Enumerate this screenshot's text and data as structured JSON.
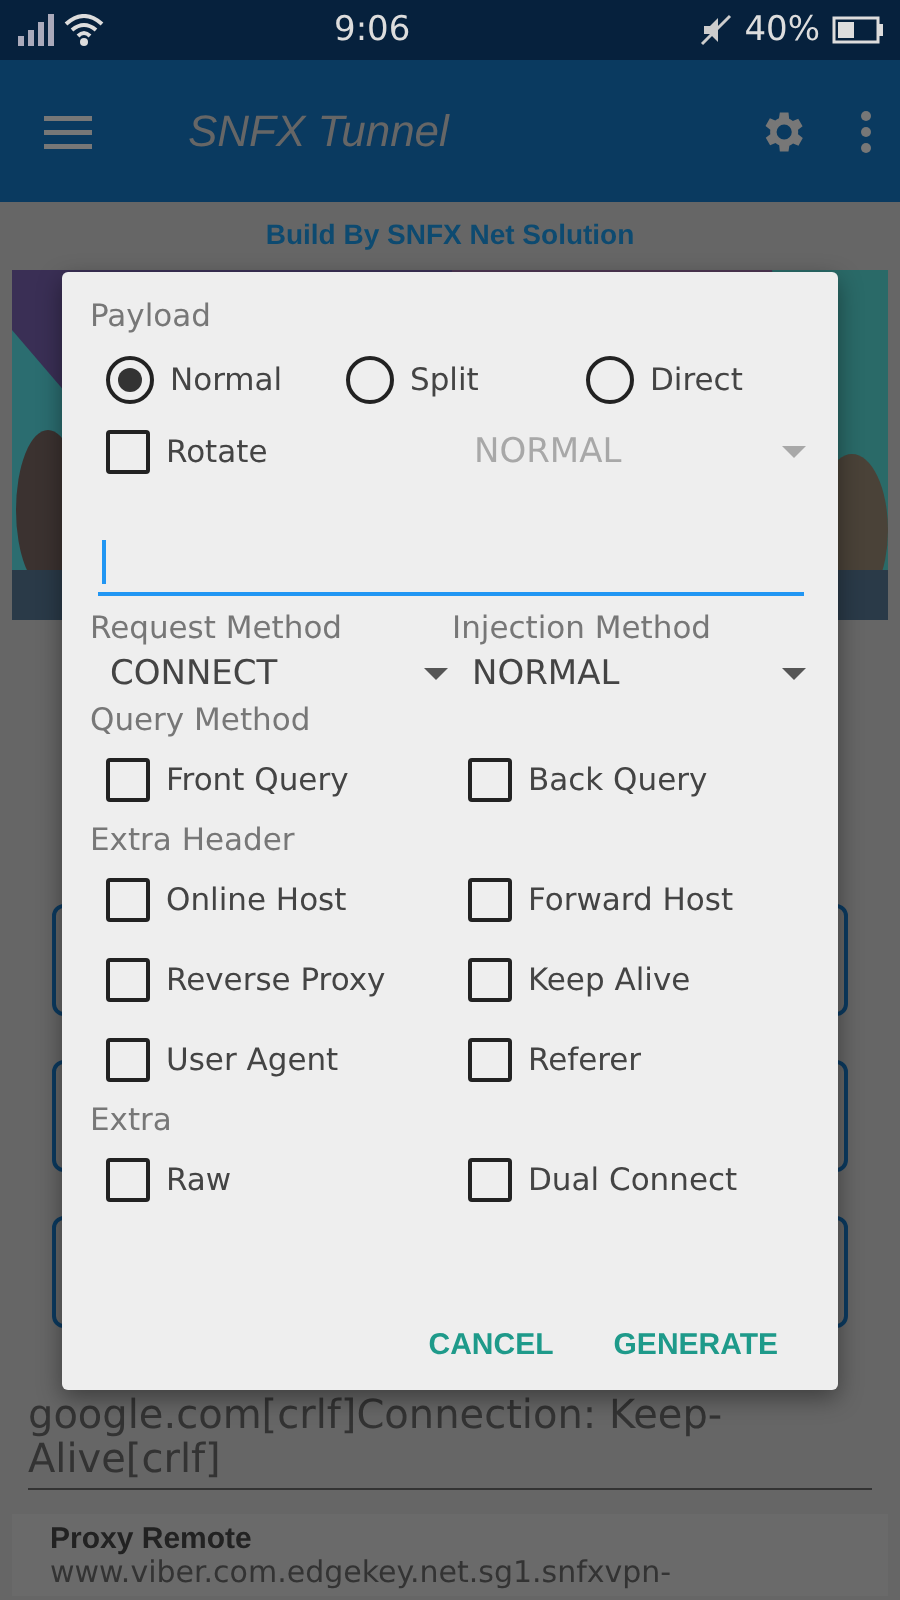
{
  "status_bar": {
    "time": "9:06",
    "battery": "40%"
  },
  "app_bar": {
    "title": "SNFX Tunnel"
  },
  "credit": "Build By SNFX Net Solution",
  "payload_field": {
    "lines": [
      "google.com[crlf]Connection: Keep-",
      "Alive[crlf]"
    ]
  },
  "proxy_card": {
    "label": "Proxy Remote",
    "value": "www.viber.com.edgekey.net.sg1.snfxvpn-"
  },
  "dialog": {
    "title": "Payload",
    "modes": [
      {
        "label": "Normal",
        "selected": true
      },
      {
        "label": "Split",
        "selected": false
      },
      {
        "label": "Direct",
        "selected": false
      }
    ],
    "rotate": {
      "label": "Rotate",
      "checked": false
    },
    "rotate_spinner": {
      "value": "NORMAL",
      "disabled": true
    },
    "input": {
      "focused": true
    },
    "request_method": {
      "label": "Request Method",
      "value": "CONNECT"
    },
    "injection_method": {
      "label": "Injection Method",
      "value": "NORMAL"
    },
    "sections": [
      {
        "title": "Query Method",
        "options": [
          {
            "label": "Front Query",
            "checked": false
          },
          {
            "label": "Back Query",
            "checked": false
          }
        ]
      },
      {
        "title": "Extra Header",
        "options": [
          {
            "label": "Online Host",
            "checked": false
          },
          {
            "label": "Forward Host",
            "checked": false
          },
          {
            "label": "Reverse Proxy",
            "checked": false
          },
          {
            "label": "Keep Alive",
            "checked": false
          },
          {
            "label": "User Agent",
            "checked": false
          },
          {
            "label": "Referer",
            "checked": false
          }
        ]
      },
      {
        "title": "Extra",
        "options": [
          {
            "label": "Raw",
            "checked": false
          },
          {
            "label": "Dual Connect",
            "checked": false
          }
        ]
      }
    ],
    "buttons": [
      "CANCEL",
      "GENERATE"
    ]
  }
}
